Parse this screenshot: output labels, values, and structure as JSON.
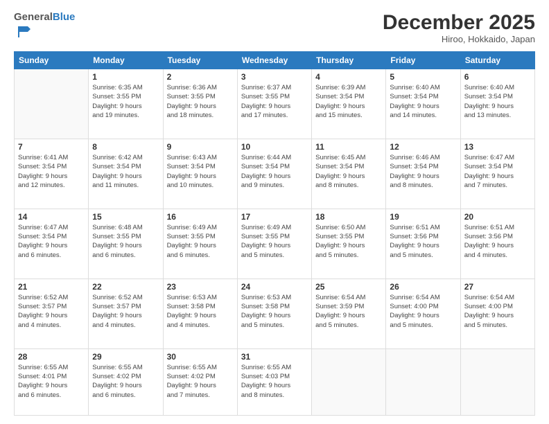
{
  "logo": {
    "general": "General",
    "blue": "Blue"
  },
  "header": {
    "month": "December 2025",
    "location": "Hiroo, Hokkaido, Japan"
  },
  "days_of_week": [
    "Sunday",
    "Monday",
    "Tuesday",
    "Wednesday",
    "Thursday",
    "Friday",
    "Saturday"
  ],
  "weeks": [
    [
      {
        "day": "",
        "info": ""
      },
      {
        "day": "1",
        "info": "Sunrise: 6:35 AM\nSunset: 3:55 PM\nDaylight: 9 hours\nand 19 minutes."
      },
      {
        "day": "2",
        "info": "Sunrise: 6:36 AM\nSunset: 3:55 PM\nDaylight: 9 hours\nand 18 minutes."
      },
      {
        "day": "3",
        "info": "Sunrise: 6:37 AM\nSunset: 3:55 PM\nDaylight: 9 hours\nand 17 minutes."
      },
      {
        "day": "4",
        "info": "Sunrise: 6:39 AM\nSunset: 3:54 PM\nDaylight: 9 hours\nand 15 minutes."
      },
      {
        "day": "5",
        "info": "Sunrise: 6:40 AM\nSunset: 3:54 PM\nDaylight: 9 hours\nand 14 minutes."
      },
      {
        "day": "6",
        "info": "Sunrise: 6:40 AM\nSunset: 3:54 PM\nDaylight: 9 hours\nand 13 minutes."
      }
    ],
    [
      {
        "day": "7",
        "info": "Sunrise: 6:41 AM\nSunset: 3:54 PM\nDaylight: 9 hours\nand 12 minutes."
      },
      {
        "day": "8",
        "info": "Sunrise: 6:42 AM\nSunset: 3:54 PM\nDaylight: 9 hours\nand 11 minutes."
      },
      {
        "day": "9",
        "info": "Sunrise: 6:43 AM\nSunset: 3:54 PM\nDaylight: 9 hours\nand 10 minutes."
      },
      {
        "day": "10",
        "info": "Sunrise: 6:44 AM\nSunset: 3:54 PM\nDaylight: 9 hours\nand 9 minutes."
      },
      {
        "day": "11",
        "info": "Sunrise: 6:45 AM\nSunset: 3:54 PM\nDaylight: 9 hours\nand 8 minutes."
      },
      {
        "day": "12",
        "info": "Sunrise: 6:46 AM\nSunset: 3:54 PM\nDaylight: 9 hours\nand 8 minutes."
      },
      {
        "day": "13",
        "info": "Sunrise: 6:47 AM\nSunset: 3:54 PM\nDaylight: 9 hours\nand 7 minutes."
      }
    ],
    [
      {
        "day": "14",
        "info": "Sunrise: 6:47 AM\nSunset: 3:54 PM\nDaylight: 9 hours\nand 6 minutes."
      },
      {
        "day": "15",
        "info": "Sunrise: 6:48 AM\nSunset: 3:55 PM\nDaylight: 9 hours\nand 6 minutes."
      },
      {
        "day": "16",
        "info": "Sunrise: 6:49 AM\nSunset: 3:55 PM\nDaylight: 9 hours\nand 6 minutes."
      },
      {
        "day": "17",
        "info": "Sunrise: 6:49 AM\nSunset: 3:55 PM\nDaylight: 9 hours\nand 5 minutes."
      },
      {
        "day": "18",
        "info": "Sunrise: 6:50 AM\nSunset: 3:55 PM\nDaylight: 9 hours\nand 5 minutes."
      },
      {
        "day": "19",
        "info": "Sunrise: 6:51 AM\nSunset: 3:56 PM\nDaylight: 9 hours\nand 5 minutes."
      },
      {
        "day": "20",
        "info": "Sunrise: 6:51 AM\nSunset: 3:56 PM\nDaylight: 9 hours\nand 4 minutes."
      }
    ],
    [
      {
        "day": "21",
        "info": "Sunrise: 6:52 AM\nSunset: 3:57 PM\nDaylight: 9 hours\nand 4 minutes."
      },
      {
        "day": "22",
        "info": "Sunrise: 6:52 AM\nSunset: 3:57 PM\nDaylight: 9 hours\nand 4 minutes."
      },
      {
        "day": "23",
        "info": "Sunrise: 6:53 AM\nSunset: 3:58 PM\nDaylight: 9 hours\nand 4 minutes."
      },
      {
        "day": "24",
        "info": "Sunrise: 6:53 AM\nSunset: 3:58 PM\nDaylight: 9 hours\nand 5 minutes."
      },
      {
        "day": "25",
        "info": "Sunrise: 6:54 AM\nSunset: 3:59 PM\nDaylight: 9 hours\nand 5 minutes."
      },
      {
        "day": "26",
        "info": "Sunrise: 6:54 AM\nSunset: 4:00 PM\nDaylight: 9 hours\nand 5 minutes."
      },
      {
        "day": "27",
        "info": "Sunrise: 6:54 AM\nSunset: 4:00 PM\nDaylight: 9 hours\nand 5 minutes."
      }
    ],
    [
      {
        "day": "28",
        "info": "Sunrise: 6:55 AM\nSunset: 4:01 PM\nDaylight: 9 hours\nand 6 minutes."
      },
      {
        "day": "29",
        "info": "Sunrise: 6:55 AM\nSunset: 4:02 PM\nDaylight: 9 hours\nand 6 minutes."
      },
      {
        "day": "30",
        "info": "Sunrise: 6:55 AM\nSunset: 4:02 PM\nDaylight: 9 hours\nand 7 minutes."
      },
      {
        "day": "31",
        "info": "Sunrise: 6:55 AM\nSunset: 4:03 PM\nDaylight: 9 hours\nand 8 minutes."
      },
      {
        "day": "",
        "info": ""
      },
      {
        "day": "",
        "info": ""
      },
      {
        "day": "",
        "info": ""
      }
    ]
  ]
}
